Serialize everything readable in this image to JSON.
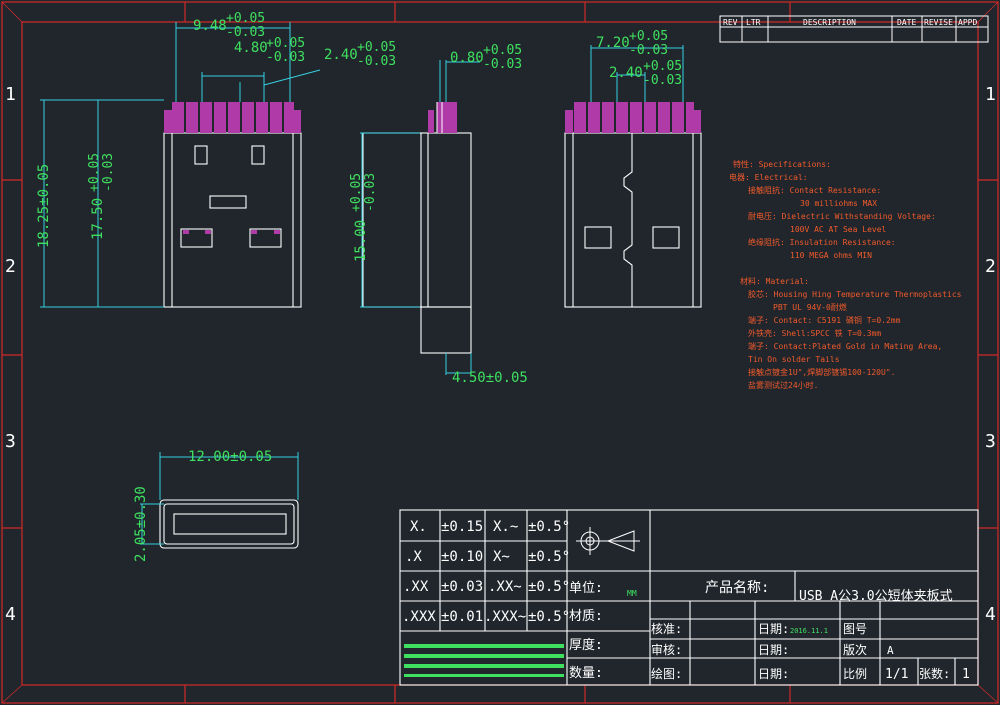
{
  "colors": {
    "background": "#20262c",
    "frame": "#d02a2a",
    "outline": "#ffffff",
    "dimension": "#3fe060",
    "pins": "#b03aa8",
    "cyan": "#36d0e0",
    "notes": "#f25a2b"
  },
  "revision_table": {
    "headers": [
      "REV",
      "LTR",
      "DESCRIPTION",
      "DATE",
      "REVISE",
      "APPD"
    ]
  },
  "zone_numbers": [
    "1",
    "2",
    "3",
    "4"
  ],
  "dimensions": {
    "front_width_total": "9.48",
    "front_width_total_tol": [
      "+0.05",
      "-0.03"
    ],
    "front_pin_span": "4.80",
    "front_pin_span_tol": [
      "+0.05",
      "-0.03"
    ],
    "front_pin_pitch": "2.40",
    "front_pin_pitch_tol": [
      "+0.05",
      "-0.03"
    ],
    "front_height_outer": "18.25±0.05",
    "front_height_inner": "17.50",
    "front_height_inner_tol": [
      "+0.05",
      "-0.03"
    ],
    "side_pin_thick": "0.80",
    "side_pin_thick_tol": [
      "+0.05",
      "-0.03"
    ],
    "side_height": "15.00",
    "side_height_tol": [
      "+0.05",
      "-0.03"
    ],
    "side_tail": "4.50±0.05",
    "back_width": "7.20",
    "back_width_tol": [
      "+0.05",
      "-0.03"
    ],
    "back_pitch": "2.40",
    "back_pitch_tol": [
      "+0.05",
      "-0.03"
    ],
    "end_width": "12.00±0.05",
    "end_height": "2.05±0.30"
  },
  "spec_notes": [
    "特性: Specifications:",
    "电器: Electrical:",
    "接触阻抗: Contact Resistance:",
    "30 milliohms MAX",
    "耐电压: Dielectric Withstanding Voltage:",
    "100V AC AT Sea Level",
    "绝缘阻抗: Insulation Resistance:",
    "110 MEGA ohms MIN",
    "材料: Material:",
    "胶芯: Housing Hing Temperature Thermoplastics",
    "PBT UL 94V-0耐燃",
    "端子: Contact: C5191 磷铜 T=0.2mm",
    "外铁壳: Shell:SPCC 铁 T=0.3mm",
    "端子: Contact:Plated Gold in Mating Area,",
    "Tin On solder Tails",
    "接触点镀金1U\",焊脚部镀锡100-120U\".",
    "盐雾测试过24小时."
  ],
  "tolerance_table": {
    "rows": [
      [
        "X.",
        "±0.15",
        "X.~",
        "±0.5°"
      ],
      [
        ".X",
        "±0.10",
        "X~",
        "±0.5°"
      ],
      [
        ".XX",
        "±0.03",
        ".XX~",
        "±0.5°"
      ],
      [
        ".XXX",
        "±0.01",
        ".XXX~",
        "±0.5°"
      ]
    ]
  },
  "title_block": {
    "unit_label": "单位:",
    "unit_value": "MM",
    "material_label": "材质:",
    "thickness_label": "厚度:",
    "quantity_label": "数量:",
    "product_name_label": "产品名称:",
    "product_name_value": "USB A公3.0公短体夹板式",
    "check_label": "核准:",
    "review_label": "审核:",
    "draw_label": "绘图:",
    "date_label": "日期:",
    "date_value": "2016.11.1",
    "drawing_no_label": "图号",
    "version_label": "版次",
    "version_value": "A",
    "scale_label": "比例",
    "scale_value": "1/1",
    "sheets_label": "张数:",
    "sheets_value": "1"
  }
}
